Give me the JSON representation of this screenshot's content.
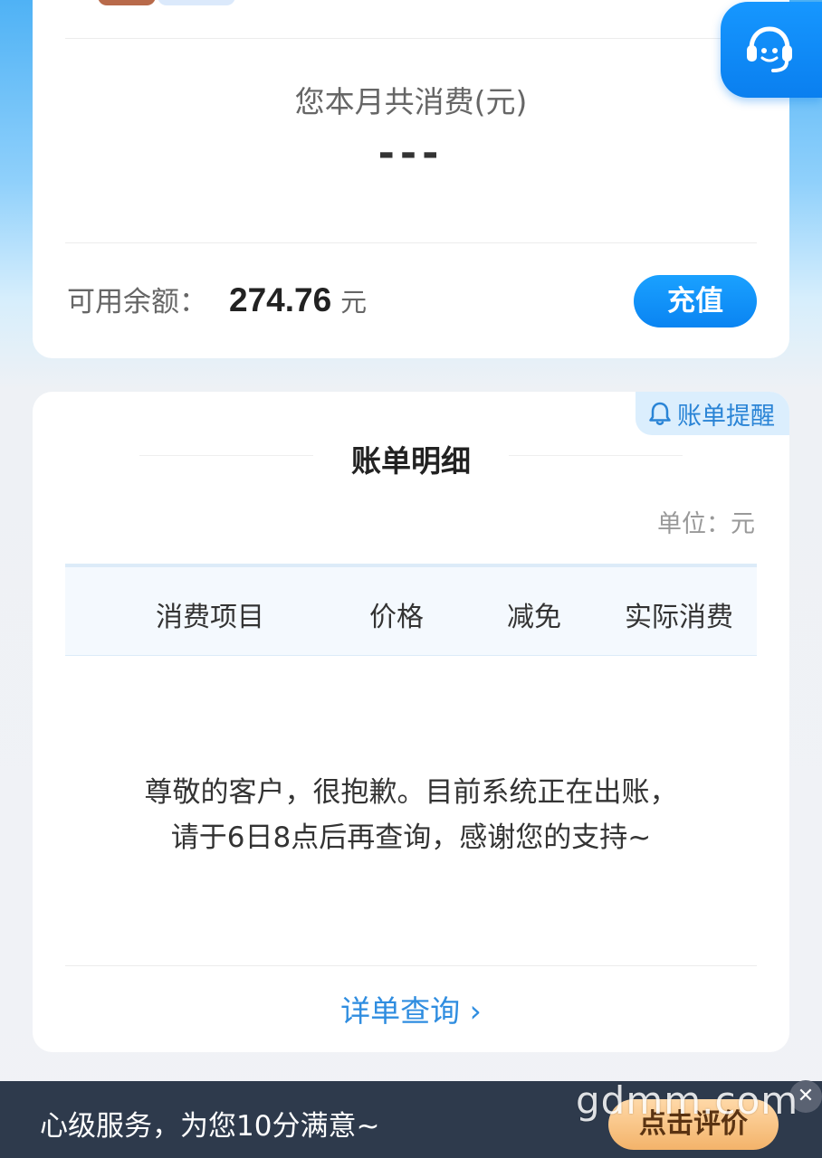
{
  "summary": {
    "month_label": "您本月共消费(元)",
    "month_value": "---",
    "balance_label": "可用余额：",
    "balance_value": "274.76",
    "balance_unit": "元",
    "recharge_label": "充值"
  },
  "service_fab": {
    "icon": "headset-icon"
  },
  "detail": {
    "reminder_label": "账单提醒",
    "title": "账单明细",
    "unit_label": "单位：元",
    "columns": [
      "消费项目",
      "价格",
      "减免",
      "实际消费"
    ],
    "empty_message_line1": "尊敬的客户，很抱歉。目前系统正在出账，",
    "empty_message_line2": "请于6日8点后再查询，感谢您的支持~",
    "detail_link": "详单查询 ›"
  },
  "banner": {
    "text": "心级服务，为您10分满意~",
    "button_label": "点击评价",
    "close_label": "✕"
  },
  "watermark": "gdmm.com",
  "colors": {
    "accent": "#0a84f2",
    "link": "#2f8de0",
    "banner_bg": "#2e3a4c"
  }
}
